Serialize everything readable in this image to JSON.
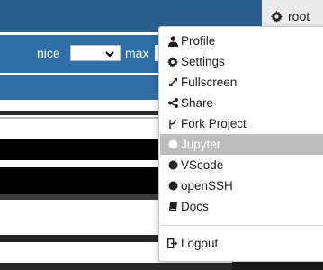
{
  "navbar": {
    "user_label": "root"
  },
  "toolbar": {
    "nice_label": "nice",
    "max_label": "max"
  },
  "user_menu": {
    "items": [
      {
        "label": "Profile",
        "icon": "user-icon"
      },
      {
        "label": "Settings",
        "icon": "gear-icon"
      },
      {
        "label": "Fullscreen",
        "icon": "expand-icon"
      },
      {
        "label": "Share",
        "icon": "share-icon"
      },
      {
        "label": "Fork Project",
        "icon": "fork-icon"
      },
      {
        "label": "Jupyter",
        "icon": "circle-icon"
      },
      {
        "label": "VScode",
        "icon": "circle-icon"
      },
      {
        "label": "openSSH",
        "icon": "circle-icon"
      },
      {
        "label": "Docs",
        "icon": "book-icon"
      },
      {
        "label": "Logout",
        "icon": "sign-out-icon"
      }
    ],
    "active_item": "Jupyter"
  },
  "colors": {
    "navbar": "#2a5f91",
    "toolbar": "#2f6fa7",
    "menu_highlight": "#bdbdbd"
  }
}
